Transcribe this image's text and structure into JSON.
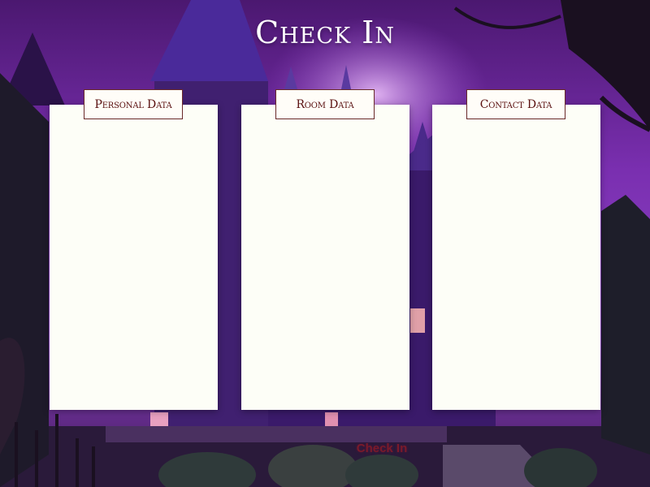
{
  "page": {
    "title": "Check In"
  },
  "panels": [
    {
      "tab_label": "Personal Data"
    },
    {
      "tab_label": "Room Data"
    },
    {
      "tab_label": "Contact Data"
    }
  ],
  "actions": {
    "checkin_label": "Check In"
  },
  "colors": {
    "background_purple": "#5b1f86",
    "panel_bg": "#fdfef7",
    "tab_text": "#5a1010",
    "tab_border": "#6a2a2a",
    "title_text": "#ffffff",
    "button_text": "#7a1a2a"
  }
}
